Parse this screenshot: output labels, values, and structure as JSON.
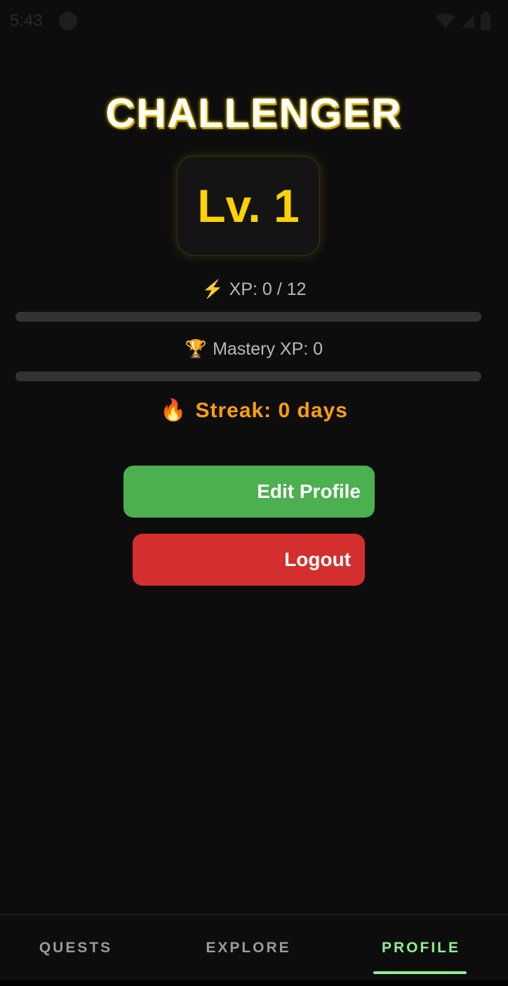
{
  "status_bar": {
    "time": "5:43"
  },
  "profile": {
    "title": "CHALLENGER",
    "level": "Lv. 1",
    "xp_icon": "⚡",
    "xp_label": "XP: 0 / 12",
    "xp_progress": 0,
    "mastery_icon": "🏆",
    "mastery_label": "Mastery XP: 0",
    "mastery_progress": 0,
    "streak_icon": "🔥",
    "streak_label": "Streak: 0 days"
  },
  "actions": {
    "edit_profile_label": "Edit Profile",
    "logout_label": "Logout"
  },
  "bottom_nav": {
    "tabs": [
      {
        "label": "QUESTS",
        "active": false
      },
      {
        "label": "EXPLORE",
        "active": false
      },
      {
        "label": "PROFILE",
        "active": true
      }
    ]
  },
  "colors": {
    "background": "#0d0d0d",
    "accent_gold": "#ffd200",
    "streak_orange": "#ff9f0a",
    "edit_green": "#4caf50",
    "logout_red": "#d32f2f",
    "active_tab_green": "#8ef08e"
  }
}
